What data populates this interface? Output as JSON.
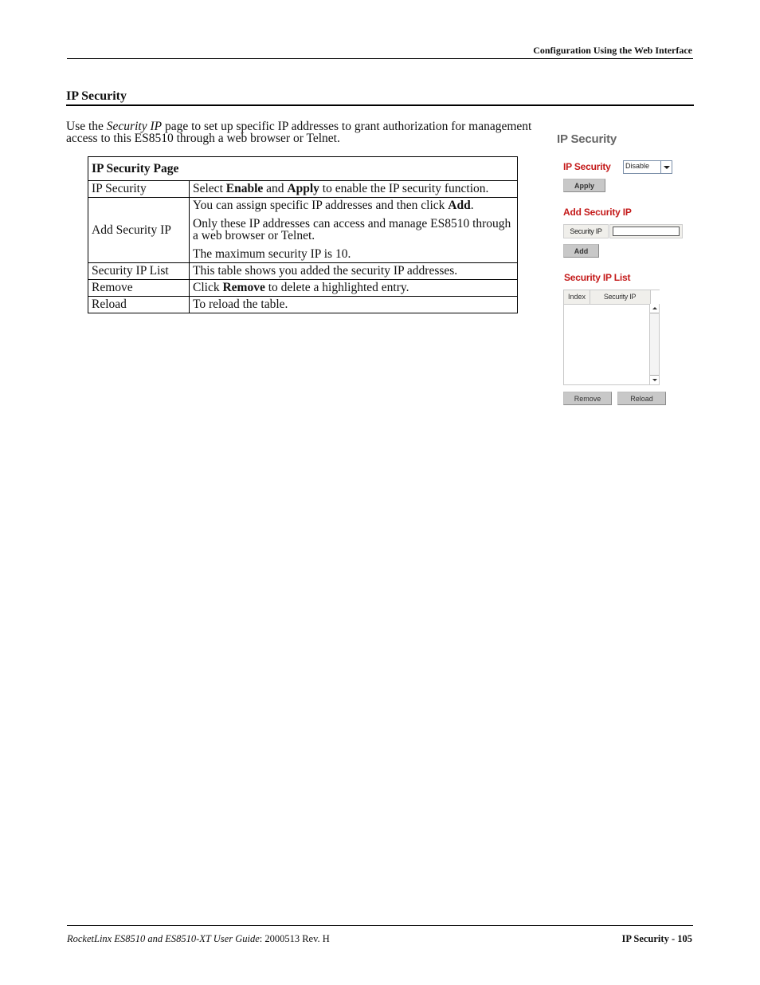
{
  "header": {
    "running_title": "Configuration Using the Web Interface"
  },
  "section": {
    "title": "IP Security",
    "intro_prefix": "Use the ",
    "intro_italic": "Security IP",
    "intro_suffix": " page to set up specific IP addresses to grant authorization for management access to this ES8510 through a web browser or Telnet."
  },
  "table": {
    "heading": "IP Security Page",
    "rows": [
      {
        "label": "IP Security",
        "parts": [
          "Select ",
          "Enable",
          " and ",
          "Apply",
          " to enable the IP security function."
        ]
      },
      {
        "label": "Add Security IP",
        "p1": [
          "You can assign specific IP addresses and then click ",
          "Add",
          "."
        ],
        "p2": "Only these IP addresses can access and manage ES8510 through a web browser or Telnet.",
        "p3": "The maximum security IP is 10."
      },
      {
        "label": "Security IP List",
        "text": "This table shows you added the security IP addresses."
      },
      {
        "label": "Remove",
        "parts": [
          "Click ",
          "Remove",
          " to delete a highlighted entry."
        ]
      },
      {
        "label": "Reload",
        "text": "To reload the table."
      }
    ]
  },
  "screenshot": {
    "title": "IP Security",
    "ip_security_label": "IP Security",
    "ip_security_select_value": "Disable",
    "apply_button": "Apply",
    "add_section_label": "Add Security IP",
    "security_ip_field_label": "Security IP",
    "security_ip_value": "",
    "add_button": "Add",
    "list_label": "Security IP List",
    "list_columns": [
      "Index",
      "Security IP"
    ],
    "list_rows": [],
    "remove_button": "Remove",
    "reload_button": "Reload",
    "label_color": "#c41a1a"
  },
  "footer": {
    "guide_title": "RocketLinx ES8510  and ES8510-XT User Guide",
    "doc_number": ": 2000513 Rev. H",
    "page_label": "IP Security - 105"
  }
}
